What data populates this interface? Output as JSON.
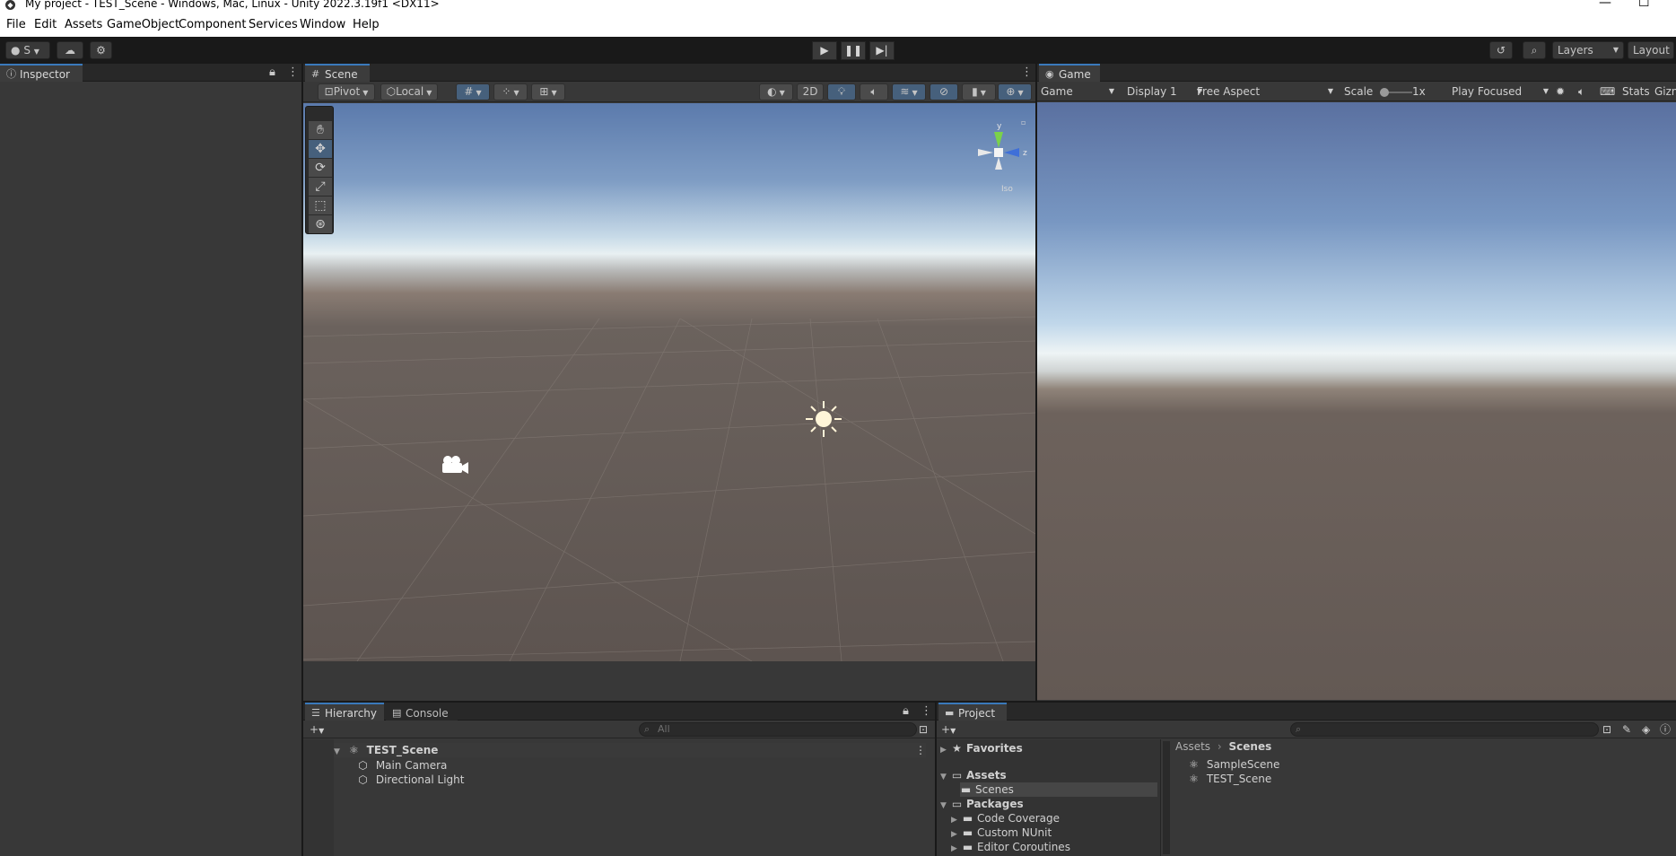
{
  "window": {
    "title": "My project - TEST_Scene - Windows, Mac, Linux - Unity 2022.3.19f1 <DX11>",
    "minimize_glyph": "—",
    "maximize_glyph": "☐"
  },
  "menu": [
    "File",
    "Edit",
    "Assets",
    "GameObject",
    "Component",
    "Services",
    "Window",
    "Help"
  ],
  "toolbar": {
    "account_label": "S",
    "layers_label": "Layers",
    "layout_label": "Layout"
  },
  "inspector": {
    "tab": "Inspector"
  },
  "scene": {
    "tab": "Scene",
    "pivot_label": "Pivot",
    "local_label": "Local",
    "mode_2d": "2D",
    "gizmo": {
      "y": "y",
      "z": "z",
      "iso": "Iso"
    }
  },
  "game": {
    "tab": "Game",
    "view_select": "Game",
    "display_select": "Display 1",
    "aspect_select": "Free Aspect",
    "scale_label": "Scale",
    "scale_value": "1x",
    "play_focused": "Play Focused",
    "stats_label": "Stats",
    "gizmos_label": "Gizn"
  },
  "hierarchy": {
    "tab": "Hierarchy",
    "console_tab": "Console",
    "search_placeholder": "All",
    "scene_name": "TEST_Scene",
    "items": [
      "Main Camera",
      "Directional Light"
    ]
  },
  "project": {
    "tab": "Project",
    "favorites": "Favorites",
    "assets": "Assets",
    "scenes_folder": "Scenes",
    "packages": "Packages",
    "package_items": [
      "Code Coverage",
      "Custom NUnit",
      "Editor Coroutines"
    ],
    "breadcrumb": [
      "Assets",
      "Scenes"
    ],
    "files": [
      "SampleScene",
      "TEST_Scene"
    ]
  },
  "colors": {
    "accent": "#3a79bb",
    "panel": "#383838",
    "toolbar": "#191919",
    "active_tool": "#46607c"
  }
}
